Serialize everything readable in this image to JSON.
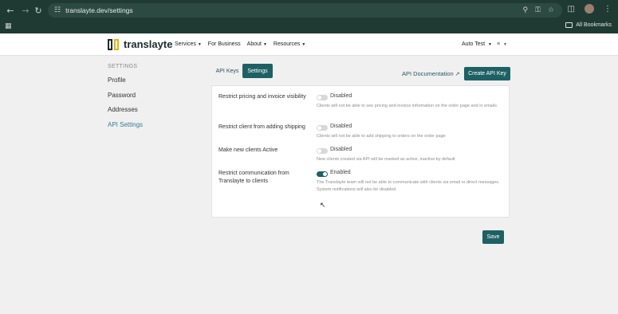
{
  "browser": {
    "url": "translayte.dev/settings",
    "bookmarks_label": "All Bookmarks",
    "icons": [
      "back-icon",
      "forward-icon",
      "reload-icon",
      "site-settings-icon",
      "zoom-icon",
      "password-key-icon",
      "bookmark-star-icon",
      "extensions-icon",
      "profile-avatar",
      "more-menu-icon",
      "apps-grid-icon",
      "folder-icon"
    ]
  },
  "header": {
    "logo_text": "translayte",
    "nav": [
      {
        "label": "Services",
        "has_caret": true
      },
      {
        "label": "For Business",
        "has_caret": false
      },
      {
        "label": "About",
        "has_caret": true
      },
      {
        "label": "Resources",
        "has_caret": true
      }
    ],
    "user_label": "Auto Test",
    "lang_label": "≡"
  },
  "sidebar": {
    "heading": "SETTINGS",
    "items": [
      {
        "label": "Profile",
        "active": false
      },
      {
        "label": "Password",
        "active": false
      },
      {
        "label": "Addresses",
        "active": false
      },
      {
        "label": "API Settings",
        "active": true
      }
    ]
  },
  "tabs": [
    {
      "label": "API Keys",
      "active": false
    },
    {
      "label": "Settings",
      "active": true
    }
  ],
  "actions": {
    "api_doc_label": "API Documentation",
    "create_label": "Create API Key"
  },
  "settings": [
    {
      "label": "Restrict pricing and invoice visibility",
      "status": "Disabled",
      "enabled": false,
      "description": "Clients will not be able to see pricing and invoice information on the order page and in emails"
    },
    {
      "label": "Restrict client from adding shipping",
      "status": "Disabled",
      "enabled": false,
      "description": "Clients will not be able to add shipping to orders on the order page"
    },
    {
      "label": "Make new clients Active",
      "status": "Disabled",
      "enabled": false,
      "description": "New clients created via API will be marked as active, inactive by default"
    },
    {
      "label": "Restrict communication from Translayte to clients",
      "status": "Enabled",
      "enabled": true,
      "description": "The Translayte team will not be able to communicate with clients via email or direct messages. System notifications will also be disabled."
    }
  ],
  "save_label": "Save",
  "colors": {
    "accent": "#1e6164",
    "chrome": "#1f3a33",
    "logo_yellow": "#e3b21b",
    "active_link": "#2f7f94"
  }
}
